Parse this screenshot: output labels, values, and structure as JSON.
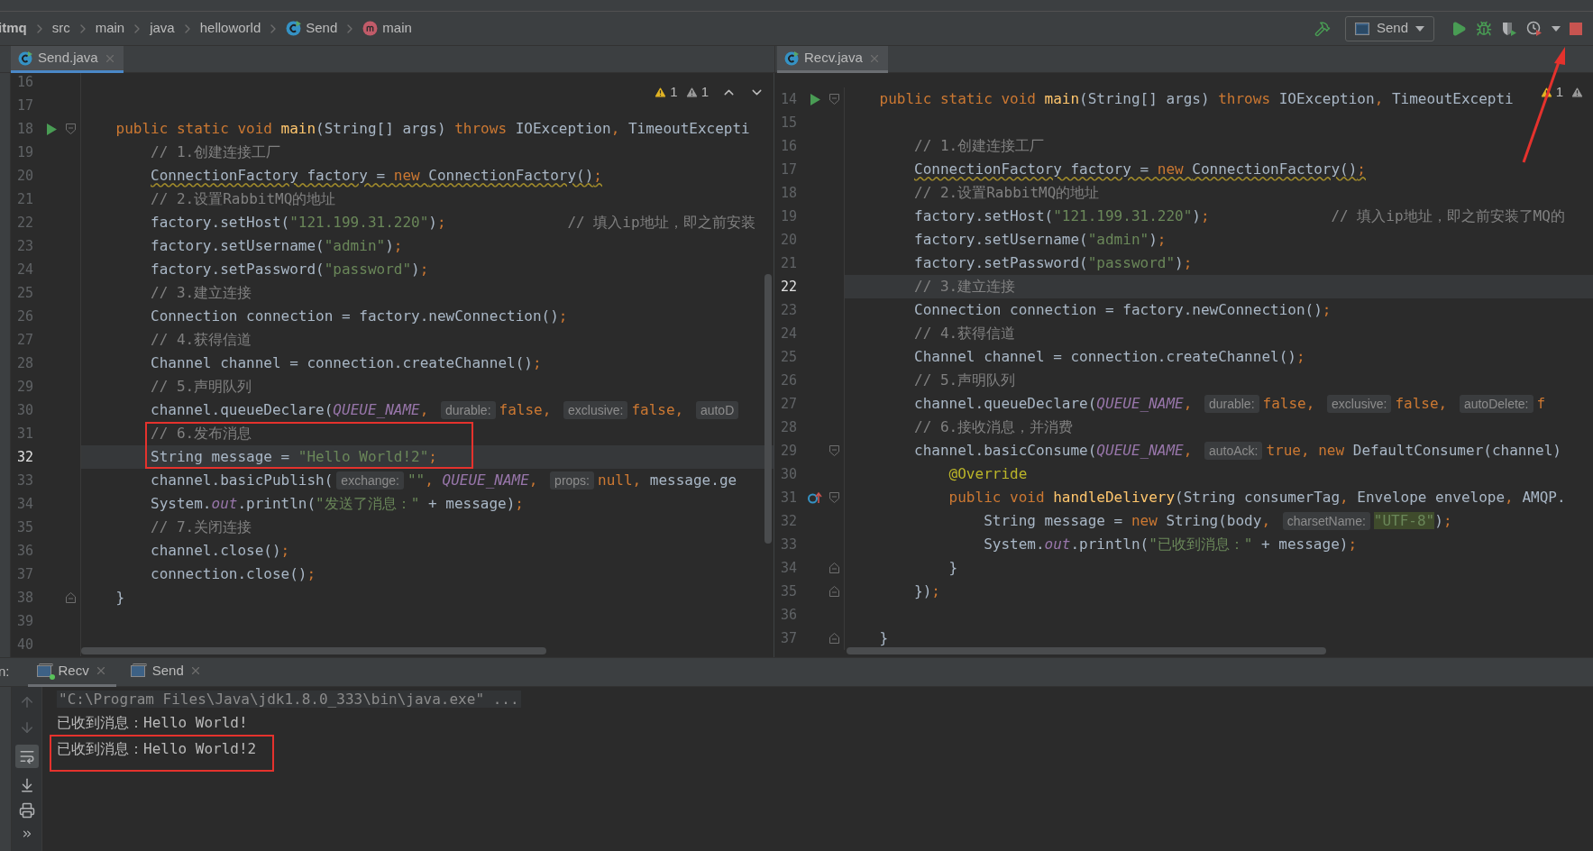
{
  "breadcrumbs": [
    {
      "kind": "project",
      "text": "itmq"
    },
    {
      "kind": "package",
      "text": "src"
    },
    {
      "kind": "package",
      "text": "main"
    },
    {
      "kind": "package",
      "text": "java"
    },
    {
      "kind": "package",
      "text": "helloworld"
    },
    {
      "kind": "class",
      "text": "Send"
    },
    {
      "kind": "method",
      "text": "main"
    }
  ],
  "run_configuration": "Send",
  "editors": [
    {
      "tab": {
        "label": "Send.java",
        "focused": true
      },
      "inspections": [
        {
          "kind": "warning",
          "count": "1"
        },
        {
          "kind": "weak",
          "count": "1"
        }
      ],
      "lines": [
        {
          "number": "16",
          "current": false
        },
        {
          "number": "17",
          "current": false
        },
        {
          "number": "18",
          "current": false,
          "warning": false,
          "markers": [
            {
              "kind": "run"
            },
            {
              "kind": "fold_start"
            }
          ],
          "tokens": [
            {
              "kind": "keyword",
              "text": "    public static void "
            },
            {
              "kind": "method",
              "text": "main"
            },
            {
              "kind": "plain",
              "text": "(String[] args) "
            },
            {
              "kind": "keyword",
              "text": "throws "
            },
            {
              "kind": "plain",
              "text": "IOException"
            },
            {
              "kind": "keyword",
              "text": ", "
            },
            {
              "kind": "plain",
              "text": "TimeoutExcepti"
            }
          ]
        },
        {
          "number": "19",
          "current": false,
          "warning": false,
          "tokens": [
            {
              "kind": "comment",
              "text": "        // 1.创建连接工厂"
            }
          ]
        },
        {
          "number": "20",
          "current": false,
          "warning": true,
          "tokens": [
            {
              "kind": "plain",
              "text": "        ConnectionFactory factory = "
            },
            {
              "kind": "keyword",
              "text": "new "
            },
            {
              "kind": "plain",
              "text": "ConnectionFactory()"
            },
            {
              "kind": "keyword",
              "text": ";"
            }
          ]
        },
        {
          "number": "21",
          "current": false,
          "warning": false,
          "tokens": [
            {
              "kind": "comment",
              "text": "        // 2.设置RabbitMQ的地址"
            }
          ]
        },
        {
          "number": "22",
          "current": false,
          "warning": false,
          "tokens": [
            {
              "kind": "plain",
              "text": "        factory.setHost("
            },
            {
              "kind": "string",
              "text": "\"121.199.31.220\""
            },
            {
              "kind": "plain",
              "text": ")"
            },
            {
              "kind": "keyword",
              "text": ";"
            },
            {
              "kind": "comment",
              "text": "              // 填入ip地址，即之前安装"
            }
          ]
        },
        {
          "number": "23",
          "current": false,
          "warning": false,
          "tokens": [
            {
              "kind": "plain",
              "text": "        factory.setUsername("
            },
            {
              "kind": "string",
              "text": "\"admin\""
            },
            {
              "kind": "plain",
              "text": ")"
            },
            {
              "kind": "keyword",
              "text": ";"
            }
          ]
        },
        {
          "number": "24",
          "current": false,
          "warning": false,
          "tokens": [
            {
              "kind": "plain",
              "text": "        factory.setPassword("
            },
            {
              "kind": "string",
              "text": "\"password\""
            },
            {
              "kind": "plain",
              "text": ")"
            },
            {
              "kind": "keyword",
              "text": ";"
            }
          ]
        },
        {
          "number": "25",
          "current": false,
          "warning": false,
          "tokens": [
            {
              "kind": "comment",
              "text": "        // 3.建立连接"
            }
          ]
        },
        {
          "number": "26",
          "current": false,
          "warning": false,
          "tokens": [
            {
              "kind": "plain",
              "text": "        Connection connection = factory.newConnection()"
            },
            {
              "kind": "keyword",
              "text": ";"
            }
          ]
        },
        {
          "number": "27",
          "current": false,
          "warning": false,
          "tokens": [
            {
              "kind": "comment",
              "text": "        // 4.获得信道"
            }
          ]
        },
        {
          "number": "28",
          "current": false,
          "warning": false,
          "tokens": [
            {
              "kind": "plain",
              "text": "        Channel channel = connection.createChannel()"
            },
            {
              "kind": "keyword",
              "text": ";"
            }
          ]
        },
        {
          "number": "29",
          "current": false,
          "warning": false,
          "tokens": [
            {
              "kind": "comment",
              "text": "        // 5.声明队列"
            }
          ]
        },
        {
          "number": "30",
          "current": false,
          "warning": false,
          "tokens": [
            {
              "kind": "plain",
              "text": "        channel.queueDeclare("
            },
            {
              "kind": "field",
              "text": "QUEUE_NAME"
            },
            {
              "kind": "keyword",
              "text": ", "
            },
            {
              "kind": "hint",
              "text": "durable:"
            },
            {
              "kind": "keyword",
              "text": "false, "
            },
            {
              "kind": "hint",
              "text": "exclusive:"
            },
            {
              "kind": "keyword",
              "text": "false, "
            },
            {
              "kind": "hint",
              "text": "autoD"
            }
          ]
        },
        {
          "number": "31",
          "current": false,
          "warning": false,
          "tokens": [
            {
              "kind": "comment",
              "text": "        // 6.发布消息"
            }
          ]
        },
        {
          "number": "32",
          "current": true,
          "warning": false,
          "tokens": [
            {
              "kind": "plain",
              "text": "        String message = "
            },
            {
              "kind": "string",
              "text": "\"Hello World!2\""
            },
            {
              "kind": "keyword",
              "text": ";"
            }
          ]
        },
        {
          "number": "33",
          "current": false,
          "warning": false,
          "tokens": [
            {
              "kind": "plain",
              "text": "        channel.basicPublish("
            },
            {
              "kind": "hint",
              "text": "exchange:"
            },
            {
              "kind": "string",
              "text": "\"\""
            },
            {
              "kind": "keyword",
              "text": ", "
            },
            {
              "kind": "field",
              "text": "QUEUE_NAME"
            },
            {
              "kind": "keyword",
              "text": ", "
            },
            {
              "kind": "hint",
              "text": "props:"
            },
            {
              "kind": "keyword",
              "text": "null, "
            },
            {
              "kind": "plain",
              "text": "message.ge"
            }
          ]
        },
        {
          "number": "34",
          "current": false,
          "warning": false,
          "tokens": [
            {
              "kind": "plain",
              "text": "        System."
            },
            {
              "kind": "field",
              "text": "out"
            },
            {
              "kind": "plain",
              "text": ".println("
            },
            {
              "kind": "string",
              "text": "\"发送了消息：\""
            },
            {
              "kind": "plain",
              "text": " + message)"
            },
            {
              "kind": "keyword",
              "text": ";"
            }
          ]
        },
        {
          "number": "35",
          "current": false,
          "warning": false,
          "tokens": [
            {
              "kind": "comment",
              "text": "        // 7.关闭连接"
            }
          ]
        },
        {
          "number": "36",
          "current": false,
          "warning": false,
          "tokens": [
            {
              "kind": "plain",
              "text": "        channel.close()"
            },
            {
              "kind": "keyword",
              "text": ";"
            }
          ]
        },
        {
          "number": "37",
          "current": false,
          "warning": false,
          "tokens": [
            {
              "kind": "plain",
              "text": "        connection.close()"
            },
            {
              "kind": "keyword",
              "text": ";"
            }
          ]
        },
        {
          "number": "38",
          "current": false,
          "warning": false,
          "markers": [
            {
              "kind": "fold_end"
            }
          ],
          "tokens": [
            {
              "kind": "plain",
              "text": "    }"
            }
          ]
        },
        {
          "number": "39",
          "current": false
        },
        {
          "number": "40",
          "current": false
        }
      ]
    },
    {
      "tab": {
        "label": "Recv.java",
        "focused": false
      },
      "inspections": [
        {
          "kind": "warning",
          "count": "1"
        },
        {
          "kind": "weak"
        }
      ],
      "lines": [
        {
          "number": "14",
          "current": false,
          "warning": false,
          "markers": [
            {
              "kind": "run"
            },
            {
              "kind": "fold_start"
            }
          ],
          "tokens": [
            {
              "kind": "keyword",
              "text": "    public static void "
            },
            {
              "kind": "method",
              "text": "main"
            },
            {
              "kind": "plain",
              "text": "(String[] args) "
            },
            {
              "kind": "keyword",
              "text": "throws "
            },
            {
              "kind": "plain",
              "text": "IOException"
            },
            {
              "kind": "keyword",
              "text": ", "
            },
            {
              "kind": "plain",
              "text": "TimeoutExcepti"
            }
          ]
        },
        {
          "number": "15",
          "current": false
        },
        {
          "number": "16",
          "current": false,
          "warning": false,
          "tokens": [
            {
              "kind": "comment",
              "text": "        // 1.创建连接工厂"
            }
          ]
        },
        {
          "number": "17",
          "current": false,
          "warning": true,
          "tokens": [
            {
              "kind": "plain",
              "text": "        ConnectionFactory factory = "
            },
            {
              "kind": "keyword",
              "text": "new "
            },
            {
              "kind": "plain",
              "text": "ConnectionFactory()"
            },
            {
              "kind": "keyword",
              "text": ";"
            }
          ]
        },
        {
          "number": "18",
          "current": false,
          "warning": false,
          "tokens": [
            {
              "kind": "comment",
              "text": "        // 2.设置RabbitMQ的地址"
            }
          ]
        },
        {
          "number": "19",
          "current": false,
          "warning": false,
          "tokens": [
            {
              "kind": "plain",
              "text": "        factory.setHost("
            },
            {
              "kind": "string",
              "text": "\"121.199.31.220\""
            },
            {
              "kind": "plain",
              "text": ")"
            },
            {
              "kind": "keyword",
              "text": ";"
            },
            {
              "kind": "comment",
              "text": "              // 填入ip地址，即之前安装了MQ的"
            }
          ]
        },
        {
          "number": "20",
          "current": false,
          "warning": false,
          "tokens": [
            {
              "kind": "plain",
              "text": "        factory.setUsername("
            },
            {
              "kind": "string",
              "text": "\"admin\""
            },
            {
              "kind": "plain",
              "text": ")"
            },
            {
              "kind": "keyword",
              "text": ";"
            }
          ]
        },
        {
          "number": "21",
          "current": false,
          "warning": false,
          "tokens": [
            {
              "kind": "plain",
              "text": "        factory.setPassword("
            },
            {
              "kind": "string",
              "text": "\"password\""
            },
            {
              "kind": "plain",
              "text": ")"
            },
            {
              "kind": "keyword",
              "text": ";"
            }
          ]
        },
        {
          "number": "22",
          "current": true,
          "warning": false,
          "tokens": [
            {
              "kind": "comment",
              "text": "        // 3.建立连接"
            }
          ]
        },
        {
          "number": "23",
          "current": false,
          "warning": false,
          "tokens": [
            {
              "kind": "plain",
              "text": "        Connection connection = factory.newConnection()"
            },
            {
              "kind": "keyword",
              "text": ";"
            }
          ]
        },
        {
          "number": "24",
          "current": false,
          "warning": false,
          "tokens": [
            {
              "kind": "comment",
              "text": "        // 4.获得信道"
            }
          ]
        },
        {
          "number": "25",
          "current": false,
          "warning": false,
          "tokens": [
            {
              "kind": "plain",
              "text": "        Channel channel = connection.createChannel()"
            },
            {
              "kind": "keyword",
              "text": ";"
            }
          ]
        },
        {
          "number": "26",
          "current": false,
          "warning": false,
          "tokens": [
            {
              "kind": "comment",
              "text": "        // 5.声明队列"
            }
          ]
        },
        {
          "number": "27",
          "current": false,
          "warning": false,
          "tokens": [
            {
              "kind": "plain",
              "text": "        channel.queueDeclare("
            },
            {
              "kind": "field",
              "text": "QUEUE_NAME"
            },
            {
              "kind": "keyword",
              "text": ", "
            },
            {
              "kind": "hint",
              "text": "durable:"
            },
            {
              "kind": "keyword",
              "text": "false, "
            },
            {
              "kind": "hint",
              "text": "exclusive:"
            },
            {
              "kind": "keyword",
              "text": "false, "
            },
            {
              "kind": "hint",
              "text": "autoDelete:"
            },
            {
              "kind": "keyword",
              "text": "f"
            }
          ]
        },
        {
          "number": "28",
          "current": false,
          "warning": false,
          "tokens": [
            {
              "kind": "comment",
              "text": "        // 6.接收消息，并消费"
            }
          ]
        },
        {
          "number": "29",
          "current": false,
          "warning": false,
          "markers": [
            {
              "kind": "fold_start"
            }
          ],
          "tokens": [
            {
              "kind": "plain",
              "text": "        channel.basicConsume("
            },
            {
              "kind": "field",
              "text": "QUEUE_NAME"
            },
            {
              "kind": "keyword",
              "text": ", "
            },
            {
              "kind": "hint",
              "text": "autoAck:"
            },
            {
              "kind": "keyword",
              "text": "true, new "
            },
            {
              "kind": "plain",
              "text": "DefaultConsumer(channel)"
            }
          ]
        },
        {
          "number": "30",
          "current": false,
          "warning": false,
          "tokens": [
            {
              "kind": "annotation",
              "text": "            @Override"
            }
          ]
        },
        {
          "number": "31",
          "current": false,
          "warning": false,
          "markers": [
            {
              "kind": "override"
            },
            {
              "kind": "fold_start"
            }
          ],
          "tokens": [
            {
              "kind": "keyword",
              "text": "            public void "
            },
            {
              "kind": "method",
              "text": "handleDelivery"
            },
            {
              "kind": "plain",
              "text": "(String consumerTag"
            },
            {
              "kind": "keyword",
              "text": ", "
            },
            {
              "kind": "plain",
              "text": "Envelope envelope"
            },
            {
              "kind": "keyword",
              "text": ", "
            },
            {
              "kind": "plain",
              "text": "AMQP."
            }
          ]
        },
        {
          "number": "32",
          "current": false,
          "warning": false,
          "tokens": [
            {
              "kind": "plain",
              "text": "                String message = "
            },
            {
              "kind": "keyword",
              "text": "new "
            },
            {
              "kind": "plain",
              "text": "String(body"
            },
            {
              "kind": "keyword",
              "text": ", "
            },
            {
              "kind": "hint",
              "text": "charsetName:"
            },
            {
              "kind": "string_highlight",
              "text": "\"UTF-8\""
            },
            {
              "kind": "plain",
              "text": ")"
            },
            {
              "kind": "keyword",
              "text": ";"
            }
          ]
        },
        {
          "number": "33",
          "current": false,
          "warning": false,
          "tokens": [
            {
              "kind": "plain",
              "text": "                System."
            },
            {
              "kind": "field",
              "text": "out"
            },
            {
              "kind": "plain",
              "text": ".println("
            },
            {
              "kind": "string",
              "text": "\"已收到消息：\""
            },
            {
              "kind": "plain",
              "text": " + message)"
            },
            {
              "kind": "keyword",
              "text": ";"
            }
          ]
        },
        {
          "number": "34",
          "current": false,
          "warning": false,
          "markers": [
            {
              "kind": "fold_end"
            }
          ],
          "tokens": [
            {
              "kind": "plain",
              "text": "            }"
            }
          ]
        },
        {
          "number": "35",
          "current": false,
          "warning": false,
          "markers": [
            {
              "kind": "fold_end"
            }
          ],
          "tokens": [
            {
              "kind": "plain",
              "text": "        })"
            },
            {
              "kind": "keyword",
              "text": ";"
            }
          ]
        },
        {
          "number": "36",
          "current": false
        },
        {
          "number": "37",
          "current": false,
          "warning": false,
          "markers": [
            {
              "kind": "fold_end"
            }
          ],
          "tokens": [
            {
              "kind": "plain",
              "text": "    }"
            }
          ]
        }
      ]
    }
  ],
  "run_panel": {
    "label": "n:",
    "tabs": [
      {
        "label": "Recv",
        "selected": true,
        "running": true
      },
      {
        "label": "Send",
        "selected": false,
        "running": false
      }
    ],
    "console": [
      {
        "kind": "command",
        "boxed": false,
        "text": "\"C:\\Program Files\\Java\\jdk1.8.0_333\\bin\\java.exe\" ..."
      },
      {
        "kind": "output",
        "boxed": false,
        "text": "已收到消息：Hello World!"
      },
      {
        "kind": "output",
        "boxed": true,
        "text": "已收到消息：Hello World!2"
      }
    ]
  }
}
